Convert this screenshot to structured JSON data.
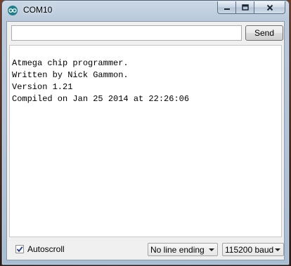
{
  "window": {
    "title": "COM10"
  },
  "input": {
    "value": "",
    "send_label": "Send"
  },
  "output": {
    "lines": [
      "",
      "Atmega chip programmer.",
      "Written by Nick Gammon.",
      "Version 1.21",
      "Compiled on Jan 25 2014 at 22:26:06"
    ]
  },
  "footer": {
    "autoscroll_label": "Autoscroll",
    "autoscroll_checked": true,
    "line_ending_selected": "No line ending",
    "baud_selected": "115200 baud"
  },
  "colors": {
    "titlebar": "#b9c9db",
    "client": "#f0f0f0"
  },
  "icons": [
    "arduino-logo-icon",
    "minimize-icon",
    "maximize-icon",
    "close-icon",
    "checkmark-icon",
    "chevron-down-icon"
  ]
}
